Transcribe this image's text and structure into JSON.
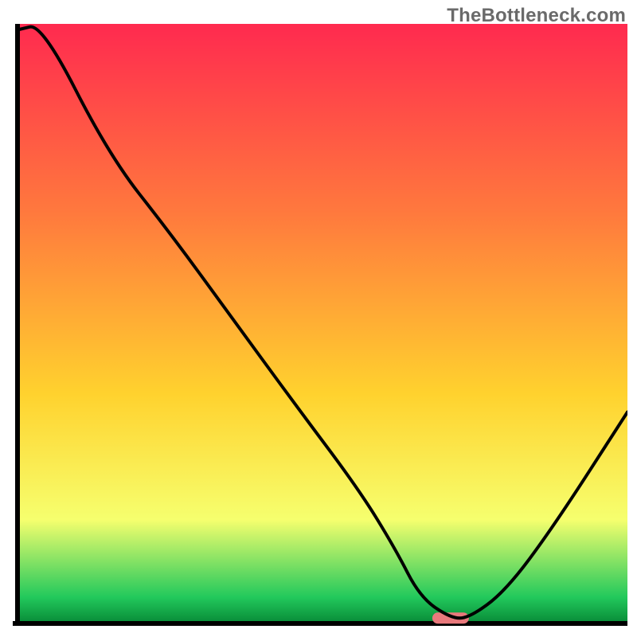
{
  "watermark": "TheBottleneck.com",
  "chart_data": {
    "type": "line",
    "title": "",
    "xlabel": "",
    "ylabel": "",
    "xlim": [
      0,
      100
    ],
    "ylim": [
      0,
      100
    ],
    "series": [
      {
        "name": "curve",
        "x": [
          0,
          4,
          15,
          25,
          35,
          45,
          56,
          62,
          66,
          71,
          74,
          80,
          88,
          100
        ],
        "values": [
          99,
          100,
          78,
          65,
          51,
          37,
          22,
          12,
          4,
          0.5,
          0.5,
          5,
          16,
          35
        ]
      }
    ],
    "optimal_marker": {
      "x_start": 68,
      "x_end": 74,
      "y": 0.5
    }
  },
  "colors": {
    "gradient_top": "#ff2a4f",
    "gradient_mid1": "#ff7a3d",
    "gradient_mid2": "#ffd22e",
    "gradient_mid3": "#f6ff6e",
    "gradient_bottom_green": "#22c95c",
    "gradient_bottom_dark": "#0a8f3a",
    "axis": "#000000",
    "curve": "#000000",
    "marker": "#e9797c"
  }
}
